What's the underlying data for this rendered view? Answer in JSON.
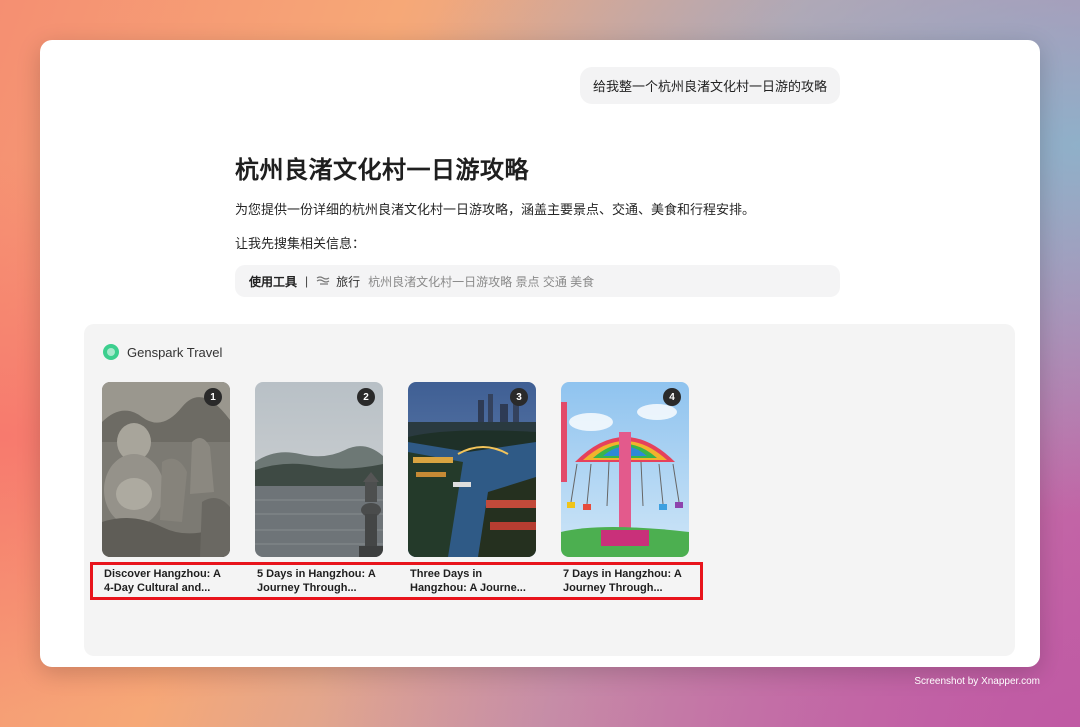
{
  "user_message": "给我整一个杭州良渚文化村一日游的攻略",
  "answer": {
    "title": "杭州良渚文化村一日游攻略",
    "intro": "为您提供一份详细的杭州良渚文化村一日游攻略，涵盖主要景点、交通、美食和行程安排。",
    "search_lead": "让我先搜集相关信息："
  },
  "tool_use": {
    "label": "使用工具",
    "separator": "|",
    "tool_name": "旅行",
    "query": "杭州良渚文化村一日游攻略 景点 交通 美食"
  },
  "travel_panel": {
    "title": "Genspark Travel",
    "cards": [
      {
        "number": "1",
        "title_line1": "Discover Hangzhou: A",
        "title_line2": "4-Day Cultural and..."
      },
      {
        "number": "2",
        "title_line1": "5 Days in Hangzhou: A",
        "title_line2": "Journey Through..."
      },
      {
        "number": "3",
        "title_line1": "Three Days in",
        "title_line2": "Hangzhou: A Journe..."
      },
      {
        "number": "4",
        "title_line1": "7 Days in Hangzhou: A",
        "title_line2": "Journey Through..."
      }
    ]
  },
  "watermark": "Screenshot by Xnapper.com",
  "colors": {
    "highlight_border": "#e8141c",
    "brand_green": "#3ccf8e"
  }
}
